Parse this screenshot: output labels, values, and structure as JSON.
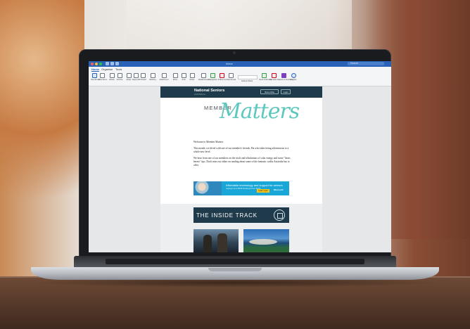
{
  "window": {
    "title": "Inbox",
    "search_placeholder": "Search"
  },
  "ribbon": {
    "tabs": [
      "Home",
      "Organise",
      "Tools"
    ],
    "buttons": [
      "New Email",
      "New Items",
      "Delete",
      "Archive",
      "Reply",
      "Reply All",
      "Forward",
      "Meeting",
      "Attachment",
      "Move",
      "Junk",
      "Rules",
      "Read/Unread",
      "Categorise",
      "Follow Up",
      "Filter Email",
      "Address Book",
      "Send & Receive",
      "Get Add-ins",
      "Send to OneNote",
      "Insights"
    ]
  },
  "email": {
    "brand": "National Seniors",
    "brand_sub": "AUSTRALIA",
    "header_buttons": [
      "View online",
      "Login"
    ],
    "masthead_small": "MEMBER",
    "masthead_script": "Matters",
    "greeting": "Welcome to Member Matters.",
    "paragraph1": "This month, we dived with one of our member's friends, Pat who takes being adventurous to a whole new level.",
    "paragraph2": "We hear from one of our members on the trials and tribulations of solar energy and some \"hears hereto\" tips. Don't miss out either on reading about some of the fantastic walks Australia has to offer.",
    "ad": {
      "title": "Affordable technology and support for seniors",
      "sub": "Laptops from $349 Desktops from $479",
      "button": "Learn more",
      "logo": "Microsoft"
    },
    "section_title": "THE INSIDE TRACK"
  }
}
